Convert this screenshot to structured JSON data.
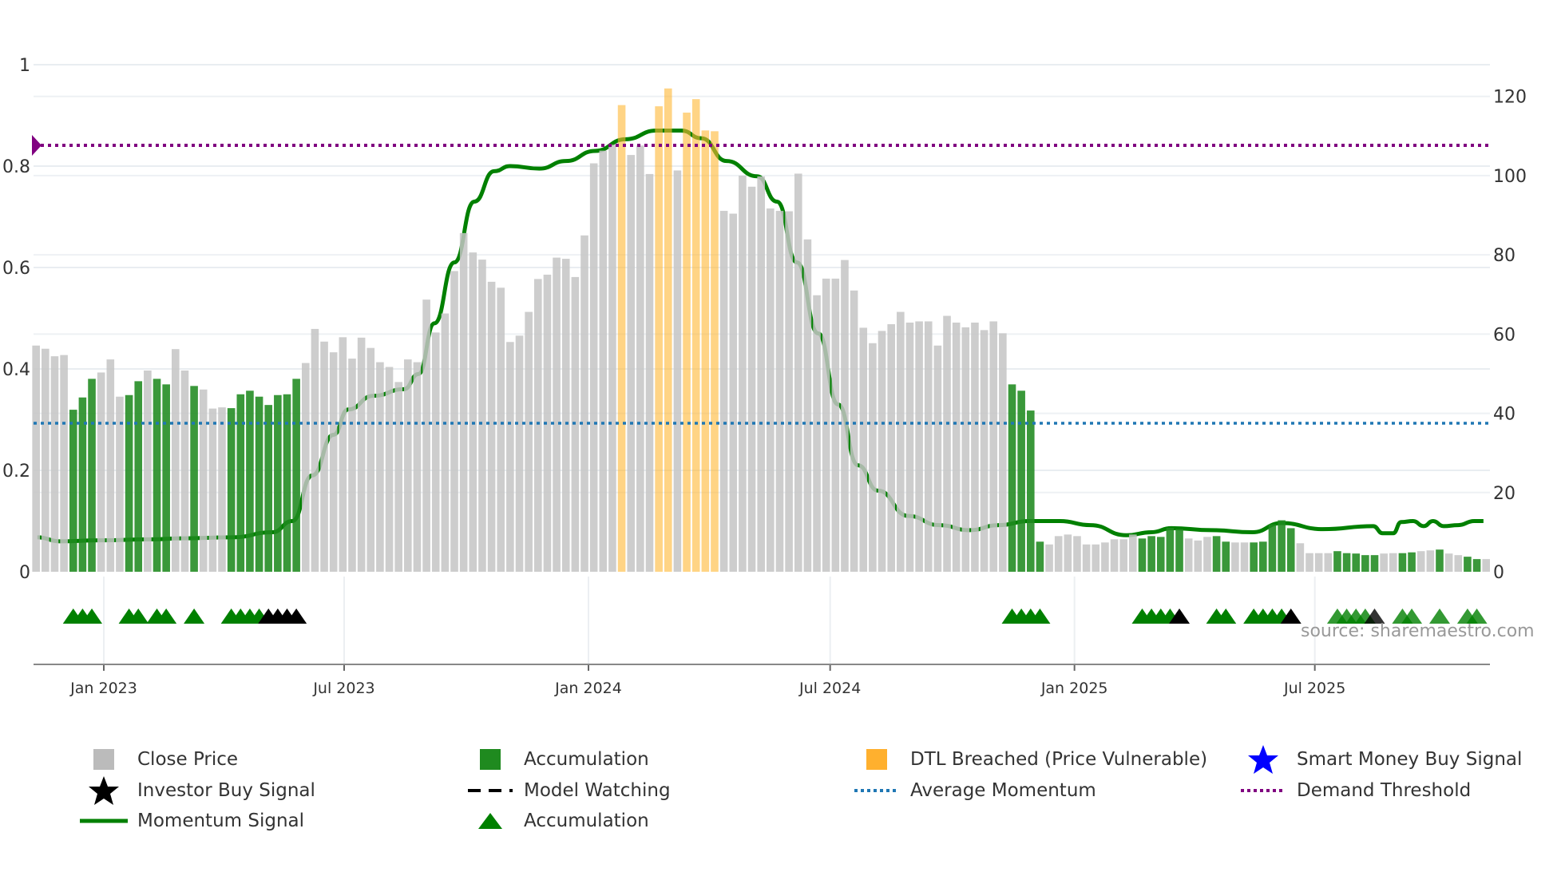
{
  "chart_data": {
    "type": "bar",
    "first_bar_date": "2022-11-11",
    "last_bar_date": "2025-11-07",
    "bar_interval": "weekly",
    "close_price": [
      57.1,
      56.3,
      54.4,
      54.7,
      40.9,
      44,
      48.7,
      50.3,
      53.6,
      44.2,
      44.6,
      48.1,
      50.8,
      48.7,
      47.3,
      56.2,
      50.8,
      46.9,
      46,
      41.2,
      41.5,
      41.3,
      44.8,
      45.7,
      44.2,
      42.1,
      44.6,
      44.8,
      48.7,
      52.7,
      61.3,
      58.1,
      55.4,
      59.2,
      53.8,
      59.1,
      56.5,
      52.9,
      51.7,
      47.9,
      53.6,
      52.9,
      68.7,
      60.4,
      65.2,
      75.9,
      85.5,
      80.6,
      78.8,
      73.2,
      71.7,
      58,
      59.6,
      65.6,
      73.9,
      75,
      79.3,
      79,
      74.4,
      84.9,
      103.1,
      106.3,
      107.8,
      117.8,
      105.2,
      107.6,
      100.4,
      117.5,
      122,
      101.3,
      115.9,
      119.3,
      111.4,
      111.2,
      91.1,
      90.4,
      100,
      97.2,
      99.8,
      91.7,
      91.1,
      91.0,
      100.5,
      83.9,
      69.8,
      74,
      74,
      78.7,
      71,
      61.6,
      57.7,
      60.8,
      62.5,
      65.6,
      62.9,
      63.2,
      63.2,
      57.1,
      64.6,
      62.9,
      61.7,
      62.9,
      61,
      63.2,
      60.2,
      47.3,
      45.7,
      40.7,
      7.6,
      6.9,
      9,
      9.4,
      9,
      6.9,
      6.9,
      7.4,
      8.2,
      8.2,
      9.4,
      8.4,
      9,
      8.8,
      11.1,
      10.8,
      8.4,
      7.9,
      8.8,
      9,
      7.6,
      7.4,
      7.4,
      7.4,
      7.6,
      12,
      13,
      11,
      7.2,
      4.7,
      4.7,
      4.7,
      5.2,
      4.7,
      4.6,
      4.2,
      4.2,
      4.6,
      4.7,
      4.7,
      4.9,
      5.2,
      5.4,
      5.6,
      4.6,
      4.2,
      3.8,
      3.2,
      3.2
    ],
    "accumulation_bars": [
      4,
      5,
      6,
      10,
      11,
      13,
      14,
      17,
      21,
      22,
      23,
      24,
      25,
      26,
      27,
      28,
      105,
      106,
      107,
      108,
      119,
      120,
      121,
      122,
      123,
      127,
      128,
      131,
      132,
      133,
      134,
      135,
      140,
      141,
      142,
      143,
      144,
      147,
      148,
      151,
      154,
      155
    ],
    "dtl_breached_bars": [
      63,
      67,
      68,
      70,
      71,
      72,
      73
    ],
    "investor_buy_bars": [
      25,
      26,
      27,
      28,
      123,
      135,
      144
    ],
    "momentum_signal": [
      [
        "2022-11-12",
        0.068
      ],
      [
        "2022-11-29",
        0.06
      ],
      [
        "2022-12-29",
        0.062
      ],
      [
        "2023-02-06",
        0.064
      ],
      [
        "2023-03-01",
        0.066
      ],
      [
        "2023-04-08",
        0.068
      ],
      [
        "2023-05-08",
        0.078
      ],
      [
        "2023-05-23",
        0.1
      ],
      [
        "2023-06-07",
        0.19
      ],
      [
        "2023-06-23",
        0.27
      ],
      [
        "2023-07-04",
        0.32
      ],
      [
        "2023-07-23",
        0.347
      ],
      [
        "2023-08-15",
        0.36
      ],
      [
        "2023-08-26",
        0.39
      ],
      [
        "2023-09-07",
        0.49
      ],
      [
        "2023-09-22",
        0.61
      ],
      [
        "2023-10-07",
        0.73
      ],
      [
        "2023-10-22",
        0.79
      ],
      [
        "2023-11-03",
        0.8
      ],
      [
        "2023-11-25",
        0.795
      ],
      [
        "2023-12-15",
        0.81
      ],
      [
        "2024-01-06",
        0.83
      ],
      [
        "2024-01-29",
        0.853
      ],
      [
        "2024-02-21",
        0.87
      ],
      [
        "2024-03-11",
        0.87
      ],
      [
        "2024-03-26",
        0.855
      ],
      [
        "2024-04-14",
        0.81
      ],
      [
        "2024-05-07",
        0.78
      ],
      [
        "2024-05-22",
        0.73
      ],
      [
        "2024-06-06",
        0.61
      ],
      [
        "2024-06-22",
        0.47
      ],
      [
        "2024-07-07",
        0.33
      ],
      [
        "2024-07-22",
        0.21
      ],
      [
        "2024-08-06",
        0.16
      ],
      [
        "2024-08-29",
        0.11
      ],
      [
        "2024-09-21",
        0.092
      ],
      [
        "2024-10-14",
        0.082
      ],
      [
        "2024-11-05",
        0.092
      ],
      [
        "2024-11-28",
        0.1
      ],
      [
        "2024-12-21",
        0.1
      ],
      [
        "2025-01-13",
        0.092
      ],
      [
        "2025-02-09",
        0.072
      ],
      [
        "2025-02-28",
        0.078
      ],
      [
        "2025-03-15",
        0.086
      ],
      [
        "2025-04-14",
        0.082
      ],
      [
        "2025-05-15",
        0.078
      ],
      [
        "2025-06-06",
        0.096
      ],
      [
        "2025-07-07",
        0.084
      ],
      [
        "2025-08-14",
        0.09
      ],
      [
        "2025-08-21",
        0.076
      ],
      [
        "2025-08-29",
        0.076
      ],
      [
        "2025-09-04",
        0.098
      ],
      [
        "2025-09-13",
        0.1
      ],
      [
        "2025-09-21",
        0.09
      ],
      [
        "2025-09-28",
        0.1
      ],
      [
        "2025-10-06",
        0.09
      ],
      [
        "2025-10-17",
        0.092
      ],
      [
        "2025-10-29",
        0.1
      ],
      [
        "2025-11-05",
        0.1
      ]
    ],
    "average_momentum": 0.293,
    "demand_threshold": 0.841,
    "left_axis": {
      "ylim": [
        0,
        1
      ],
      "ticks": [
        "0",
        "0.2",
        "0.4",
        "0.6",
        "0.8",
        "1"
      ]
    },
    "right_axis": {
      "ylim": [
        0,
        128
      ],
      "ticks": [
        "0",
        "20",
        "40",
        "60",
        "80",
        "100",
        "120"
      ]
    },
    "x_ticks": [
      {
        "date": "2023-01-01",
        "label": "Jan 2023"
      },
      {
        "date": "2023-07-01",
        "label": "Jul 2023"
      },
      {
        "date": "2024-01-01",
        "label": "Jan 2024"
      },
      {
        "date": "2024-07-01",
        "label": "Jul 2024"
      },
      {
        "date": "2025-01-01",
        "label": "Jan 2025"
      },
      {
        "date": "2025-07-01",
        "label": "Jul 2025"
      }
    ],
    "grid": true,
    "legend_position": "bottom",
    "colors": {
      "close": "#c4c4c4",
      "accumulation": "#1f8a1f",
      "dtl": "#ffb733",
      "momentum": "#008000",
      "average": "#1f77b4",
      "threshold": "#800080",
      "investor": "#000000",
      "smart_money": "#0000ff"
    }
  },
  "source_text": "source: sharemaestro.com",
  "legend": [
    "Close Price",
    "Accumulation",
    "DTL Breached (Price Vulnerable)",
    "Smart Money Buy Signal",
    "Investor Buy Signal",
    "Model Watching",
    "Average Momentum",
    "Demand Threshold",
    "Momentum Signal",
    "Accumulation"
  ]
}
